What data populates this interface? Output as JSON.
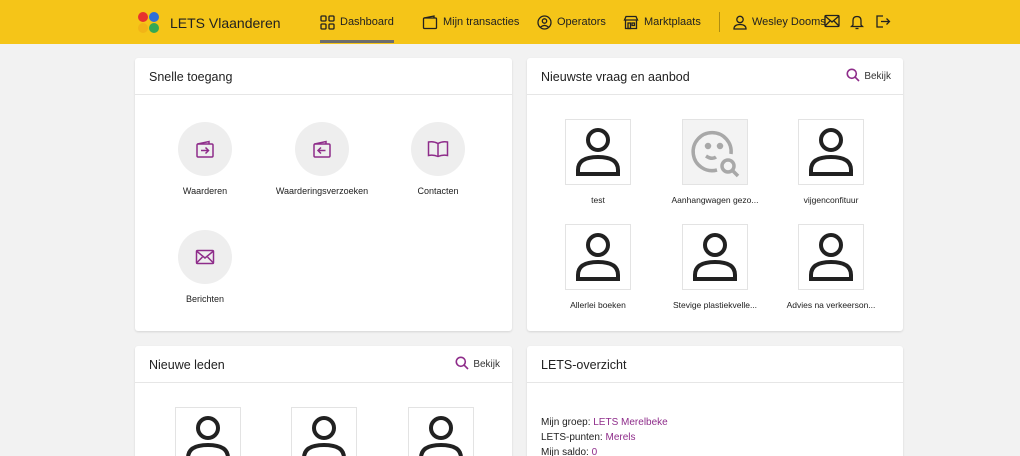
{
  "app": {
    "brand": "LETS Vlaanderen"
  },
  "nav": {
    "dashboard": "Dashboard",
    "transactions": "Mijn transacties",
    "operators": "Operators",
    "marketplace": "Marktplaats",
    "user": "Wesley Dooms"
  },
  "icons": {
    "logo": "four-colored-dots-logo",
    "dashboard": "grid-icon",
    "transactions": "wallet-icon",
    "operators": "user-circle-icon",
    "marketplace": "shop-icon",
    "user": "user-icon",
    "messages": "envelope-icon",
    "notifications": "bell-icon",
    "logout": "logout-icon"
  },
  "colors": {
    "topbar": "#f5c518",
    "accent": "#8e2c8a",
    "background": "#f2f2f2",
    "logo_dots": [
      "#e8322d",
      "#2f6fd6",
      "#f2b417",
      "#34a853"
    ]
  },
  "quick_access": {
    "title": "Snelle toegang",
    "items": [
      {
        "label": "Waarderen",
        "icon": "wallet-arrow-right-icon"
      },
      {
        "label": "Waarderingsverzoeken",
        "icon": "wallet-arrow-left-icon"
      },
      {
        "label": "Contacten",
        "icon": "book-icon"
      },
      {
        "label": "Berichten",
        "icon": "envelope-icon"
      }
    ]
  },
  "offers": {
    "title": "Nieuwste vraag en aanbod",
    "view_label": "Bekijk",
    "items": [
      {
        "label": "test",
        "icon": "user-icon"
      },
      {
        "label": "Aanhangwagen gezo...",
        "icon": "face-search-icon"
      },
      {
        "label": "vijgenconfituur",
        "icon": "user-icon"
      },
      {
        "label": "Allerlei boeken",
        "icon": "user-icon"
      },
      {
        "label": "Stevige plastiekvelle...",
        "icon": "user-icon"
      },
      {
        "label": "Advies na verkeerson...",
        "icon": "user-icon"
      }
    ]
  },
  "new_members": {
    "title": "Nieuwe leden",
    "view_label": "Bekijk"
  },
  "overview": {
    "title": "LETS-overzicht",
    "group_label": "Mijn groep:",
    "group_value": "LETS Merelbeke",
    "points_label": "LETS-punten:",
    "points_value": "Merels",
    "balance_label": "Mijn saldo:",
    "balance_value": "0"
  }
}
